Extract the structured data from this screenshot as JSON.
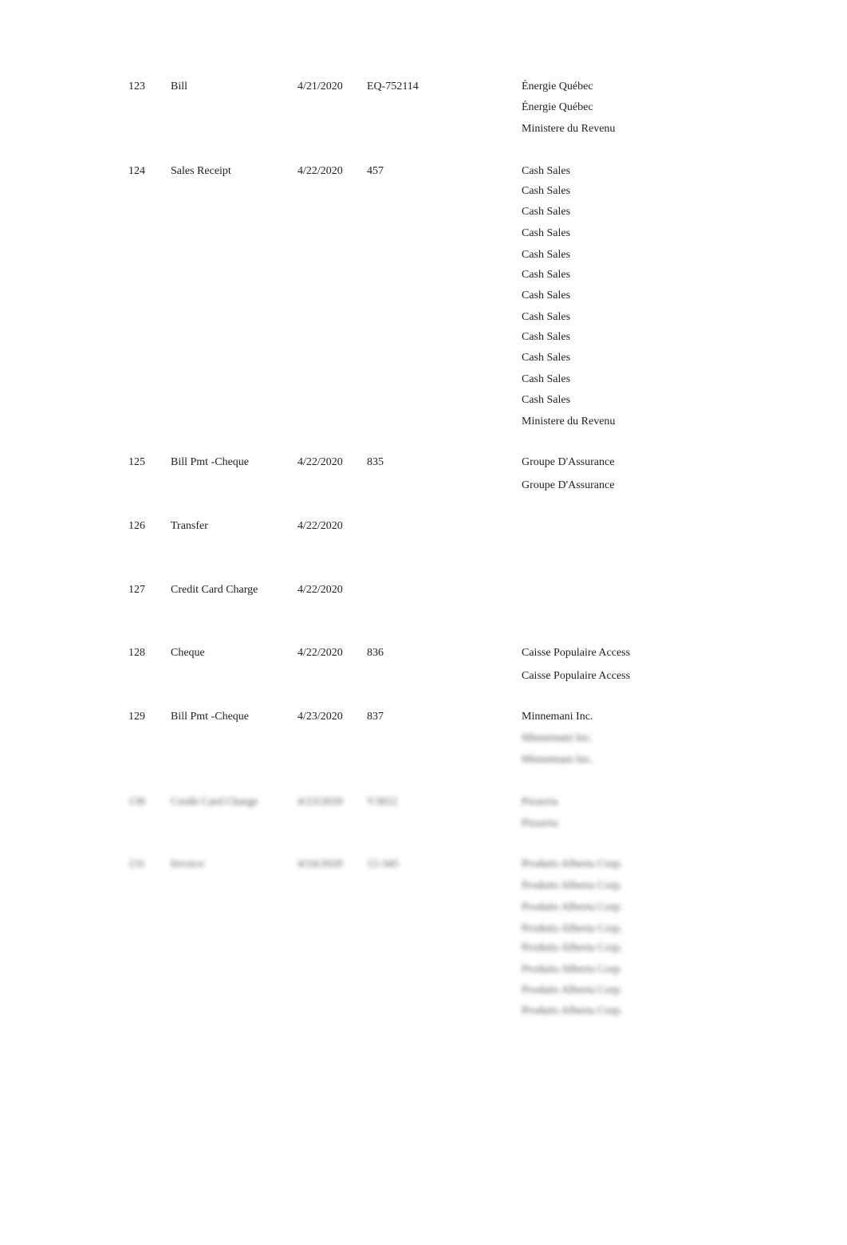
{
  "entries": [
    {
      "num": "123",
      "type": "Bill",
      "date": "4/21/2020",
      "ref": "EQ-752114",
      "names": [
        "Énergie Québec",
        "Énergie Québec",
        "Ministere du Revenu"
      ]
    },
    {
      "num": "124",
      "type": "Sales Receipt",
      "date": "4/22/2020",
      "ref": "457",
      "names": [
        "Cash Sales",
        "Cash Sales",
        "Cash Sales",
        "Cash Sales",
        "Cash Sales",
        "Cash Sales",
        "Cash Sales",
        "Cash Sales",
        "Cash Sales",
        "Cash Sales",
        "Cash Sales",
        "Cash Sales",
        "Ministere du Revenu"
      ]
    },
    {
      "num": "125",
      "type": "Bill Pmt -Cheque",
      "date": "4/22/2020",
      "ref": "835",
      "names": [
        "Groupe D'Assurance",
        "Groupe D'Assurance"
      ]
    },
    {
      "num": "126",
      "type": "Transfer",
      "date": "4/22/2020",
      "ref": "",
      "names": []
    },
    {
      "num": "127",
      "type": "Credit Card Charge",
      "date": "4/22/2020",
      "ref": "",
      "names": []
    },
    {
      "num": "128",
      "type": "Cheque",
      "date": "4/22/2020",
      "ref": "836",
      "names": [
        "Caisse Populaire Access",
        "Caisse Populaire Access"
      ]
    },
    {
      "num": "129",
      "type": "Bill Pmt -Cheque",
      "date": "4/23/2020",
      "ref": "837",
      "names": [
        "Minnemani Inc.",
        "Minnemani Inc.",
        "Minnemani Inc."
      ],
      "blurred_names_from": 1
    },
    {
      "num": "130",
      "type": "Credit Card Charge",
      "date": "4/23/2020",
      "ref": "V3652",
      "names": [
        "Pizzeria",
        "Pizzeria"
      ],
      "blurred": true
    },
    {
      "num": "131",
      "type": "Invoice",
      "date": "4/24/2020",
      "ref": "12-345",
      "names": [
        "Produits Alberta Corp.",
        "Produits Alberta Corp.",
        "Produits Alberta Corp.",
        "Produits Alberta Corp.",
        "Produits Alberta Corp.",
        "Produits Alberta Corp.",
        "Produits Alberta Corp.",
        "Produits Alberta Corp."
      ],
      "blurred": true
    }
  ]
}
